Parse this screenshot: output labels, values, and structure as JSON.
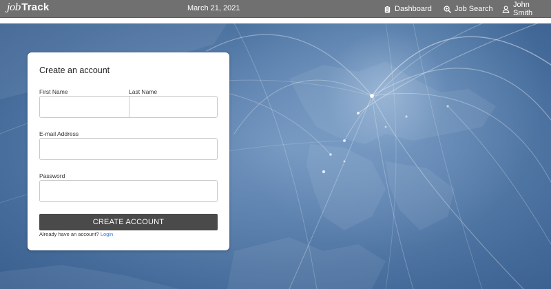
{
  "navbar": {
    "brand_prefix": "job",
    "brand_name": "Track",
    "date": "March 21, 2021",
    "dashboard_label": "Dashboard",
    "job_search_label": "Job Search",
    "user_name": "John Smith"
  },
  "form": {
    "title": "Create an account",
    "first_name_label": "First Name",
    "last_name_label": "Last Name",
    "email_label": "E-mail Address",
    "password_label": "Password",
    "first_name_value": "",
    "last_name_value": "",
    "email_value": "",
    "password_value": "",
    "submit_label": "CREATE ACCOUNT",
    "login_prompt": "Already have an account?",
    "login_link_label": "Login"
  },
  "colors": {
    "navbar_bg": "#707070",
    "button_bg": "#4a4a4a",
    "link": "#3a7bd5",
    "hero_blue": "#4a6f9d"
  },
  "icons": {
    "dashboard": "clipboard-icon",
    "job_search": "magnifier-plus-icon",
    "user": "user-icon"
  }
}
